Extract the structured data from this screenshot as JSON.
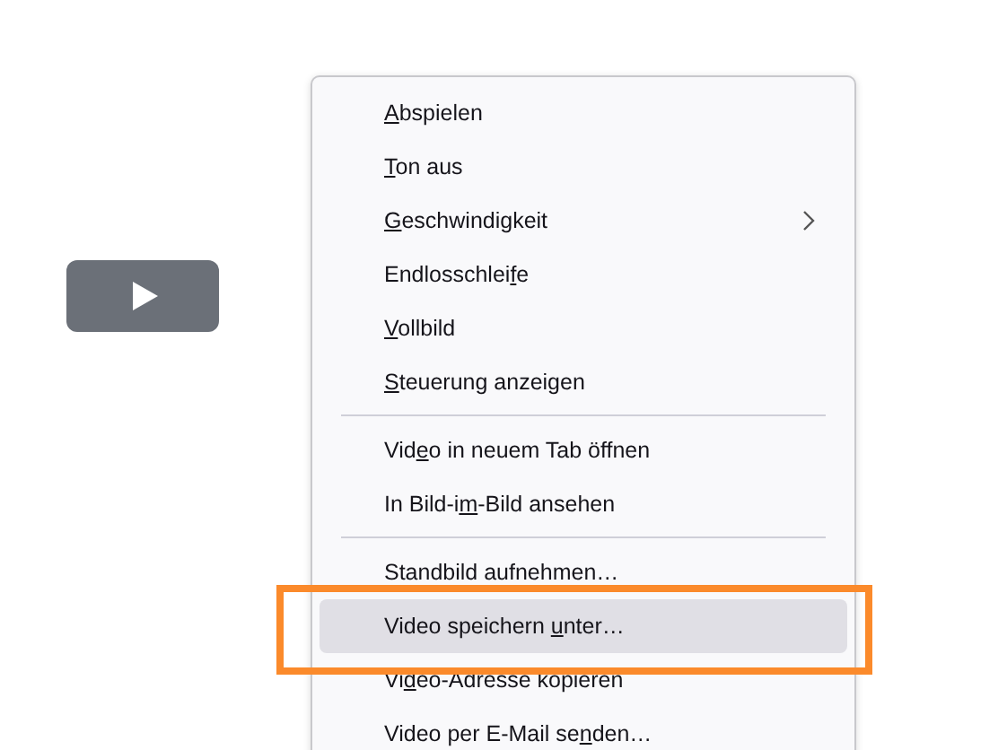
{
  "player": {
    "kind": "play-button"
  },
  "menu": {
    "groups": [
      {
        "items": [
          {
            "key": "A",
            "after": "bspielen",
            "submenu": false,
            "selected": false
          },
          {
            "key": "T",
            "after": "on aus",
            "submenu": false,
            "selected": false
          },
          {
            "key": "G",
            "after": "eschwindigkeit",
            "submenu": true,
            "selected": false
          },
          {
            "before": "Endlosschlei",
            "key": "f",
            "after": "e",
            "submenu": false,
            "selected": false
          },
          {
            "key": "V",
            "after": "ollbild",
            "submenu": false,
            "selected": false
          },
          {
            "key": "S",
            "after": "teuerung anzeigen",
            "submenu": false,
            "selected": false
          }
        ]
      },
      {
        "items": [
          {
            "before": "Vid",
            "key": "e",
            "after": "o in neuem Tab öffnen",
            "submenu": false,
            "selected": false
          },
          {
            "before": "In Bild-i",
            "key": "m",
            "after": "-Bild ansehen",
            "submenu": false,
            "selected": false
          }
        ]
      },
      {
        "items": [
          {
            "before": "Standbild aufnehmen…",
            "submenu": false,
            "selected": false
          },
          {
            "before": "Video speichern ",
            "key": "u",
            "after": "nter…",
            "submenu": false,
            "selected": true
          },
          {
            "before": "Vi",
            "key": "d",
            "after": "eo-Adresse kopieren",
            "submenu": false,
            "selected": false
          },
          {
            "before": "Video per E-Mail se",
            "key": "n",
            "after": "den…",
            "submenu": false,
            "selected": false
          }
        ]
      }
    ]
  }
}
